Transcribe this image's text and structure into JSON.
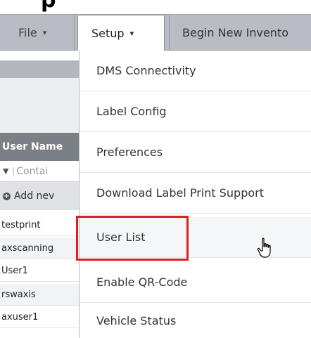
{
  "window": {
    "title_fragment": "p"
  },
  "navbar": {
    "file_label": "File",
    "setup_label": "Setup",
    "begin_label": "Begin New Invento",
    "caret": "▾"
  },
  "grid": {
    "column_header": "User Name",
    "filter_placeholder": "Contai",
    "add_new_label": "Add nev",
    "rows": [
      "testprint",
      "axscanning",
      "User1",
      "rswaxis",
      "axuser1"
    ]
  },
  "setup_menu": {
    "items": [
      "DMS Connectivity",
      "Label Config",
      "Preferences",
      "Download Label Print Support",
      "User List",
      "Enable QR-Code",
      "Vehicle Status"
    ],
    "highlighted_item": "User List"
  },
  "colors": {
    "navbar_bg": "#b9bcc2",
    "column_header_bg": "#7b7f86",
    "highlight_border": "#e02020"
  },
  "icons": [
    "caret-down-icon",
    "filter-funnel-icon",
    "add-circle-icon",
    "hand-pointer-cursor-icon"
  ]
}
